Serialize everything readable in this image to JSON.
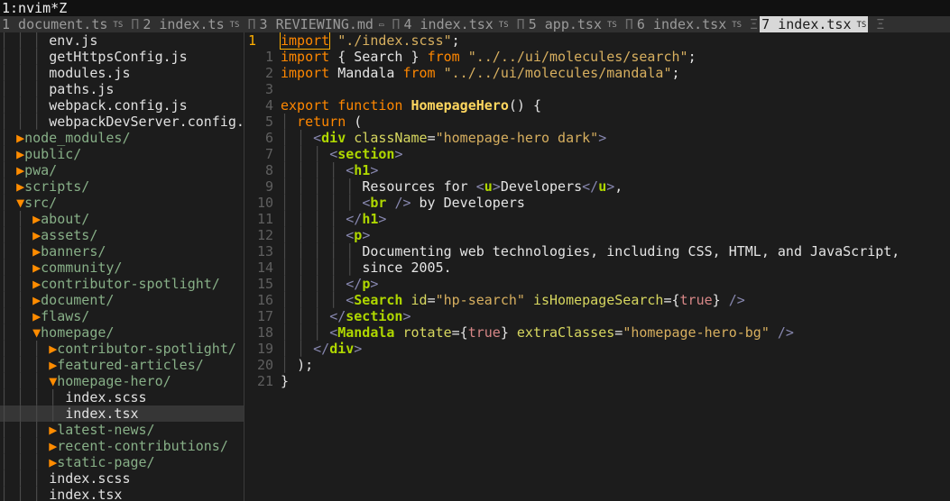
{
  "window": {
    "title": "1:nvim*Z"
  },
  "tabs": [
    {
      "num": "1",
      "label": "document.ts",
      "suffix": "TS",
      "sep": "Π"
    },
    {
      "num": "2",
      "label": "index.ts",
      "suffix": "TS",
      "sep": "Π"
    },
    {
      "num": "3",
      "label": "REVIEWING.md",
      "suffix": "▭",
      "sep": "Π"
    },
    {
      "num": "4",
      "label": "index.tsx",
      "suffix": "TS",
      "sep": "Π"
    },
    {
      "num": "5",
      "label": "app.tsx",
      "suffix": "TS",
      "sep": "Π"
    },
    {
      "num": "6",
      "label": "index.tsx",
      "suffix": "TS",
      "sep": "Ξ"
    },
    {
      "num": "7",
      "label": "index.tsx",
      "suffix": "TS",
      "sep": "Ξ",
      "active": true
    }
  ],
  "tree": [
    {
      "indent": "│ │ │ ",
      "arrow": "",
      "name": "env.js",
      "kind": "file"
    },
    {
      "indent": "│ │ │ ",
      "arrow": "",
      "name": "getHttpsConfig.js",
      "kind": "file"
    },
    {
      "indent": "│ │ │ ",
      "arrow": "",
      "name": "modules.js",
      "kind": "file"
    },
    {
      "indent": "│ │ │ ",
      "arrow": "",
      "name": "paths.js",
      "kind": "file"
    },
    {
      "indent": "│ │ │ ",
      "arrow": "",
      "name": "webpack.config.js",
      "kind": "file"
    },
    {
      "indent": "│ │ │ ",
      "arrow": "",
      "name": "webpackDevServer.config.",
      "kind": "file"
    },
    {
      "indent": "│ ",
      "arrow": "▶",
      "name": "node_modules/",
      "kind": "dir"
    },
    {
      "indent": "│ ",
      "arrow": "▶",
      "name": "public/",
      "kind": "dir"
    },
    {
      "indent": "│ ",
      "arrow": "▶",
      "name": "pwa/",
      "kind": "dir"
    },
    {
      "indent": "│ ",
      "arrow": "▶",
      "name": "scripts/",
      "kind": "dir"
    },
    {
      "indent": "│ ",
      "arrow": "▼",
      "name": "src/",
      "kind": "dir"
    },
    {
      "indent": "│ │ ",
      "arrow": "▶",
      "name": "about/",
      "kind": "dir"
    },
    {
      "indent": "│ │ ",
      "arrow": "▶",
      "name": "assets/",
      "kind": "dir"
    },
    {
      "indent": "│ │ ",
      "arrow": "▶",
      "name": "banners/",
      "kind": "dir"
    },
    {
      "indent": "│ │ ",
      "arrow": "▶",
      "name": "community/",
      "kind": "dir"
    },
    {
      "indent": "│ │ ",
      "arrow": "▶",
      "name": "contributor-spotlight/",
      "kind": "dir"
    },
    {
      "indent": "│ │ ",
      "arrow": "▶",
      "name": "document/",
      "kind": "dir"
    },
    {
      "indent": "│ │ ",
      "arrow": "▶",
      "name": "flaws/",
      "kind": "dir"
    },
    {
      "indent": "│ │ ",
      "arrow": "▼",
      "name": "homepage/",
      "kind": "dir"
    },
    {
      "indent": "│ │ │ ",
      "arrow": "▶",
      "name": "contributor-spotlight/",
      "kind": "dir"
    },
    {
      "indent": "│ │ │ ",
      "arrow": "▶",
      "name": "featured-articles/",
      "kind": "dir"
    },
    {
      "indent": "│ │ │ ",
      "arrow": "▼",
      "name": "homepage-hero/",
      "kind": "dir"
    },
    {
      "indent": "│ │ │ │ ",
      "arrow": "",
      "name": "index.scss",
      "kind": "file"
    },
    {
      "indent": "│ │ │ │ ",
      "arrow": "",
      "name": "index.tsx",
      "kind": "file",
      "selected": true
    },
    {
      "indent": "│ │ │ ",
      "arrow": "▶",
      "name": "latest-news/",
      "kind": "dir"
    },
    {
      "indent": "│ │ │ ",
      "arrow": "▶",
      "name": "recent-contributions/",
      "kind": "dir"
    },
    {
      "indent": "│ │ │ ",
      "arrow": "▶",
      "name": "static-page/",
      "kind": "dir"
    },
    {
      "indent": "│ │ │ ",
      "arrow": "",
      "name": "index.scss",
      "kind": "file"
    },
    {
      "indent": "│ │ │ ",
      "arrow": "",
      "name": "index.tsx",
      "kind": "file"
    }
  ],
  "editor": {
    "lines": [
      {
        "num": "1",
        "current": true,
        "tokens": [
          [
            "kw",
            "import"
          ],
          [
            "txt",
            " "
          ],
          [
            "str",
            "\"./index.scss\""
          ],
          [
            "txt",
            ";"
          ]
        ]
      },
      {
        "num": "1",
        "tokens": [
          [
            "kw",
            "import"
          ],
          [
            "txt",
            " { Search } "
          ],
          [
            "kw",
            "from"
          ],
          [
            "txt",
            " "
          ],
          [
            "str",
            "\"../../ui/molecules/search\""
          ],
          [
            "txt",
            ";"
          ]
        ]
      },
      {
        "num": "2",
        "tokens": [
          [
            "kw",
            "import"
          ],
          [
            "txt",
            " Mandala "
          ],
          [
            "kw",
            "from"
          ],
          [
            "txt",
            " "
          ],
          [
            "str",
            "\"../../ui/molecules/mandala\""
          ],
          [
            "txt",
            ";"
          ]
        ]
      },
      {
        "num": "3",
        "tokens": []
      },
      {
        "num": "4",
        "tokens": [
          [
            "kw",
            "export"
          ],
          [
            "txt",
            " "
          ],
          [
            "kw",
            "function"
          ],
          [
            "txt",
            " "
          ],
          [
            "fn",
            "HomepageHero"
          ],
          [
            "txt",
            "() {"
          ]
        ]
      },
      {
        "num": "5",
        "tokens": [
          [
            "ig",
            "│ "
          ],
          [
            "kw",
            "return"
          ],
          [
            "txt",
            " ("
          ]
        ]
      },
      {
        "num": "6",
        "tokens": [
          [
            "ig",
            "│ │ "
          ],
          [
            "pun",
            "<"
          ],
          [
            "tag",
            "div"
          ],
          [
            "txt",
            " "
          ],
          [
            "attr",
            "className"
          ],
          [
            "txt",
            "="
          ],
          [
            "str",
            "\"homepage-hero dark\""
          ],
          [
            "pun",
            ">"
          ]
        ]
      },
      {
        "num": "7",
        "tokens": [
          [
            "ig",
            "│ │ │ "
          ],
          [
            "pun",
            "<"
          ],
          [
            "tag",
            "section"
          ],
          [
            "pun",
            ">"
          ]
        ]
      },
      {
        "num": "8",
        "tokens": [
          [
            "ig",
            "│ │ │ │ "
          ],
          [
            "pun",
            "<"
          ],
          [
            "tag",
            "h1"
          ],
          [
            "pun",
            ">"
          ]
        ]
      },
      {
        "num": "9",
        "tokens": [
          [
            "ig",
            "│ │ │ │ │ "
          ],
          [
            "txt",
            "Resources for "
          ],
          [
            "pun",
            "<"
          ],
          [
            "tag",
            "u"
          ],
          [
            "pun",
            ">"
          ],
          [
            "txt",
            "Developers"
          ],
          [
            "pun",
            "</"
          ],
          [
            "tag",
            "u"
          ],
          [
            "pun",
            ">"
          ],
          [
            "txt",
            ","
          ]
        ]
      },
      {
        "num": "10",
        "tokens": [
          [
            "ig",
            "│ │ │ │ │ "
          ],
          [
            "pun",
            "<"
          ],
          [
            "tag",
            "br"
          ],
          [
            "txt",
            " "
          ],
          [
            "pun",
            "/>"
          ],
          [
            "txt",
            " by Developers"
          ]
        ]
      },
      {
        "num": "11",
        "tokens": [
          [
            "ig",
            "│ │ │ │ "
          ],
          [
            "pun",
            "</"
          ],
          [
            "tag",
            "h1"
          ],
          [
            "pun",
            ">"
          ]
        ]
      },
      {
        "num": "12",
        "tokens": [
          [
            "ig",
            "│ │ │ │ "
          ],
          [
            "pun",
            "<"
          ],
          [
            "tag",
            "p"
          ],
          [
            "pun",
            ">"
          ]
        ]
      },
      {
        "num": "13",
        "tokens": [
          [
            "ig",
            "│ │ │ │ │ "
          ],
          [
            "txt",
            "Documenting web technologies, including CSS, HTML, and JavaScript,"
          ]
        ]
      },
      {
        "num": "14",
        "tokens": [
          [
            "ig",
            "│ │ │ │ │ "
          ],
          [
            "txt",
            "since 2005."
          ]
        ]
      },
      {
        "num": "15",
        "tokens": [
          [
            "ig",
            "│ │ │ │ "
          ],
          [
            "pun",
            "</"
          ],
          [
            "tag",
            "p"
          ],
          [
            "pun",
            ">"
          ]
        ]
      },
      {
        "num": "16",
        "tokens": [
          [
            "ig",
            "│ │ │ │ "
          ],
          [
            "pun",
            "<"
          ],
          [
            "tag",
            "Search"
          ],
          [
            "txt",
            " "
          ],
          [
            "attr",
            "id"
          ],
          [
            "txt",
            "="
          ],
          [
            "str",
            "\"hp-search\""
          ],
          [
            "txt",
            " "
          ],
          [
            "attr",
            "isHomepageSearch"
          ],
          [
            "txt",
            "={"
          ],
          [
            "bool",
            "true"
          ],
          [
            "txt",
            "} "
          ],
          [
            "pun",
            "/>"
          ]
        ]
      },
      {
        "num": "17",
        "tokens": [
          [
            "ig",
            "│ │ │ "
          ],
          [
            "pun",
            "</"
          ],
          [
            "tag",
            "section"
          ],
          [
            "pun",
            ">"
          ]
        ]
      },
      {
        "num": "18",
        "tokens": [
          [
            "ig",
            "│ │ │ "
          ],
          [
            "pun",
            "<"
          ],
          [
            "tag",
            "Mandala"
          ],
          [
            "txt",
            " "
          ],
          [
            "attr",
            "rotate"
          ],
          [
            "txt",
            "={"
          ],
          [
            "bool",
            "true"
          ],
          [
            "txt",
            "} "
          ],
          [
            "attr",
            "extraClasses"
          ],
          [
            "txt",
            "="
          ],
          [
            "str",
            "\"homepage-hero-bg\""
          ],
          [
            "txt",
            " "
          ],
          [
            "pun",
            "/>"
          ]
        ]
      },
      {
        "num": "19",
        "tokens": [
          [
            "ig",
            "│ │ "
          ],
          [
            "pun",
            "</"
          ],
          [
            "tag",
            "div"
          ],
          [
            "pun",
            ">"
          ]
        ]
      },
      {
        "num": "20",
        "tokens": [
          [
            "ig",
            "│ "
          ],
          [
            "txt",
            ");"
          ]
        ]
      },
      {
        "num": "21",
        "tokens": [
          [
            "txt",
            "}"
          ]
        ]
      }
    ]
  }
}
